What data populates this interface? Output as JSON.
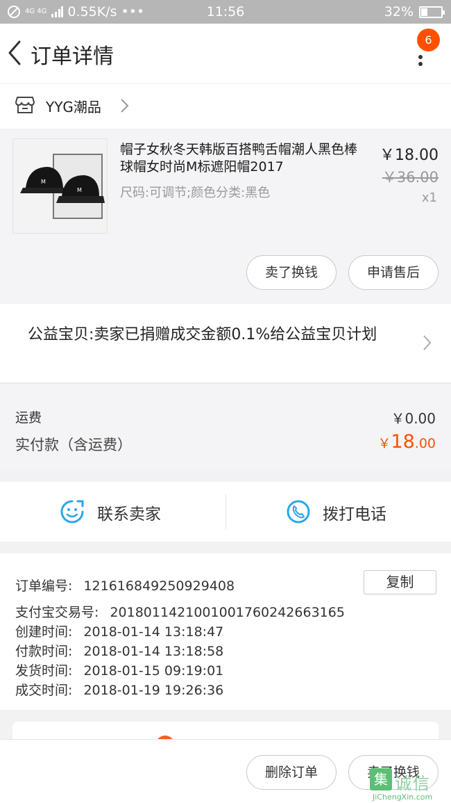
{
  "status_bar": {
    "network": "4G 4G",
    "speed": "0.55K/s",
    "dots": "•••",
    "time": "11:56",
    "battery_text": "32%",
    "battery_level": 0.32
  },
  "nav": {
    "title": "订单详情",
    "badge": "6"
  },
  "shop": {
    "name": "YYG潮品"
  },
  "item": {
    "title": "帽子女秋冬天韩版百搭鸭舌帽潮人黑色棒球帽女时尚M标遮阳帽2017",
    "sku": "尺码:可调节;颜色分类:黑色",
    "price": "￥18.00",
    "original_price": "￥36.00",
    "quantity": "x1",
    "actions": [
      "卖了换钱",
      "申请售后"
    ]
  },
  "charity": {
    "text": "公益宝贝:卖家已捐赠成交金额0.1%给公益宝贝计划"
  },
  "payment": {
    "freight_label": "运费",
    "freight_value": "￥0.00",
    "total_label": "实付款（含运费）",
    "total_currency": "￥",
    "total_int": "18",
    "total_dec": ".00"
  },
  "contact": {
    "seller_label": "联系卖家",
    "phone_label": "拨打电话"
  },
  "order_info": {
    "rows": [
      {
        "label": "订单编号:",
        "value": "121616849250929408"
      },
      {
        "label": "支付宝交易号:",
        "value": "2018011421001001760242663165"
      },
      {
        "label": "创建时间:",
        "value": "2018-01-14 13:18:47"
      },
      {
        "label": "付款时间:",
        "value": "2018-01-14 13:18:58"
      },
      {
        "label": "发货时间:",
        "value": "2018-01-15 09:19:01"
      },
      {
        "label": "成交时间:",
        "value": "2018-01-19 19:26:36"
      }
    ],
    "copy_label": "复制"
  },
  "bottom_bar": {
    "delete_label": "删除订单",
    "sell_label": "卖了换钱"
  },
  "watermark": {
    "box": "集",
    "cn": "诚信",
    "en": "JiChengXin.com"
  },
  "colors": {
    "accent": "#ff5000",
    "icon_blue": "#2aa6e8"
  }
}
